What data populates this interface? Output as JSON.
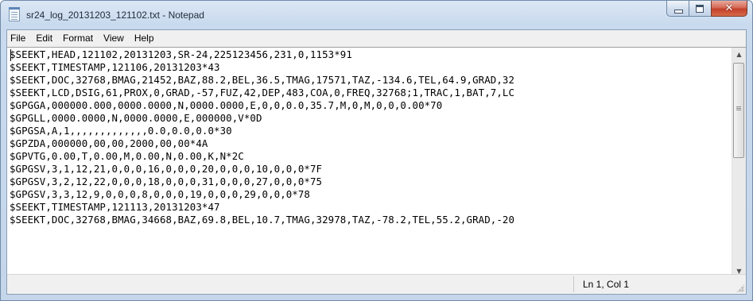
{
  "window": {
    "title": "sr24_log_20131203_121102.txt - Notepad",
    "close_glyph": "✕"
  },
  "menu": [
    "File",
    "Edit",
    "Format",
    "View",
    "Help"
  ],
  "editor": {
    "lines": [
      "$SEEKT,HEAD,121102,20131203,SR-24,225123456,231,0,1153*91",
      "$SEEKT,TIMESTAMP,121106,20131203*43",
      "$SEEKT,DOC,32768,BMAG,21452,BAZ,88.2,BEL,36.5,TMAG,17571,TAZ,-134.6,TEL,64.9,GRAD,32",
      "$SEEKT,LCD,DSIG,61,PROX,0,GRAD,-57,FUZ,42,DEP,483,COA,0,FREQ,32768;1,TRAC,1,BAT,7,LC",
      "$GPGGA,000000.000,0000.0000,N,0000.0000,E,0,0,0.0,35.7,M,0,M,0,0,0.00*70",
      "$GPGLL,0000.0000,N,0000.0000,E,000000,V*0D",
      "$GPGSA,A,1,,,,,,,,,,,,,0.0,0.0,0.0*30",
      "$GPZDA,000000,00,00,2000,00,00*4A",
      "$GPVTG,0.00,T,0.00,M,0.00,N,0.00,K,N*2C",
      "$GPGSV,3,1,12,21,0,0,0,16,0,0,0,20,0,0,0,10,0,0,0*7F",
      "$GPGSV,3,2,12,22,0,0,0,18,0,0,0,31,0,0,0,27,0,0,0*75",
      "$GPGSV,3,3,12,9,0,0,0,8,0,0,0,19,0,0,0,29,0,0,0*78",
      "$SEEKT,TIMESTAMP,121113,20131203*47",
      "$SEEKT,DOC,32768,BMAG,34668,BAZ,69.8,BEL,10.7,TMAG,32978,TAZ,-78.2,TEL,55.2,GRAD,-20"
    ]
  },
  "scrollbars": {
    "up": "▲",
    "down": "▼",
    "left": "◀",
    "right": "▶"
  },
  "status": {
    "position": "Ln 1, Col 1"
  }
}
